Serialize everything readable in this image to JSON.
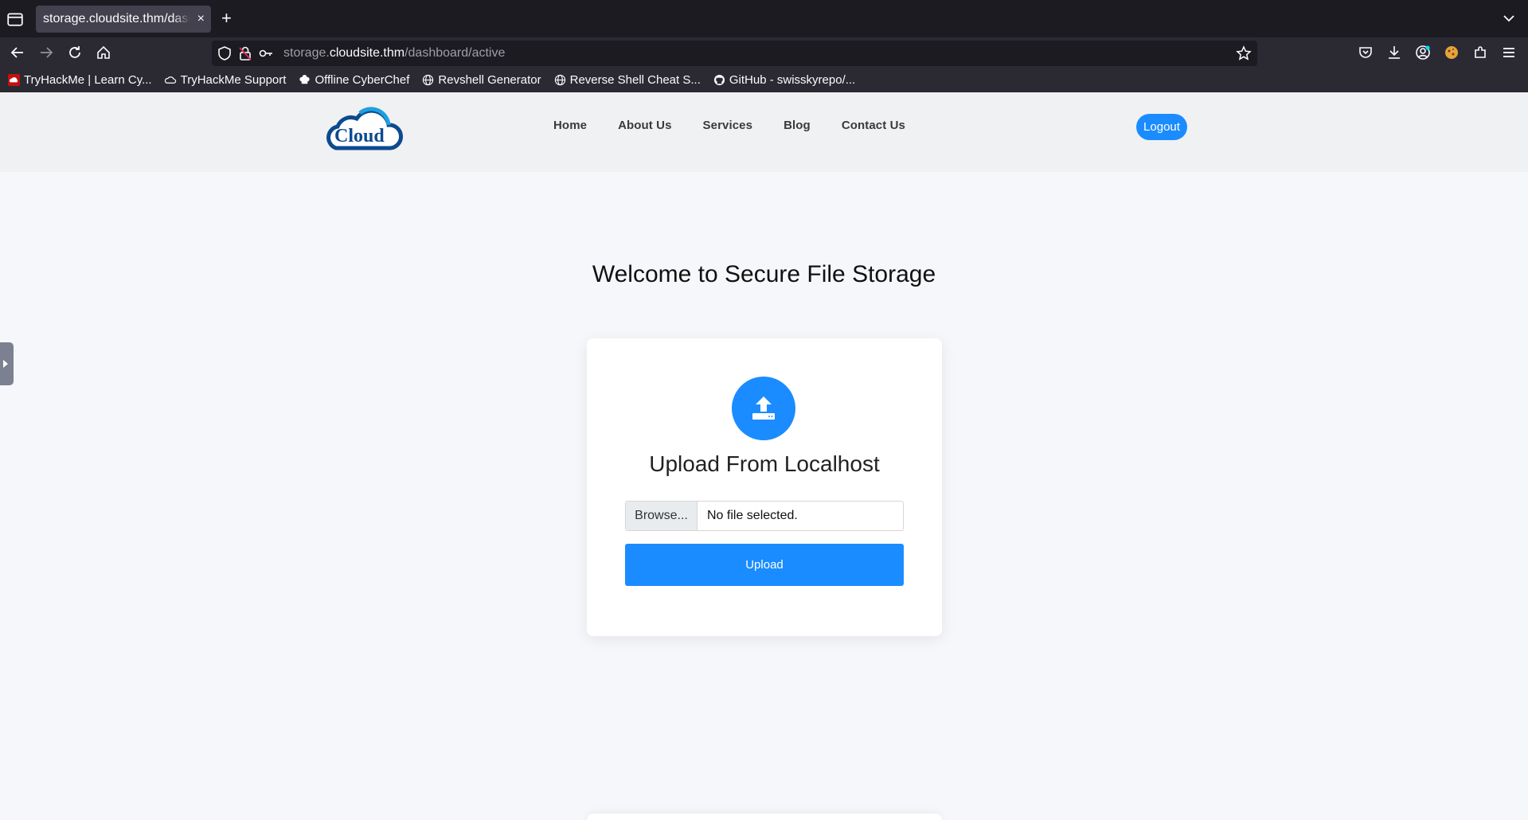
{
  "browser": {
    "tab_title": "storage.cloudsite.thm/dashboard/active",
    "tab_close": "×",
    "new_tab": "+",
    "url_prefix": "storage.",
    "url_domain": "cloudsite.thm",
    "url_path": "/dashboard/active",
    "bookmarks": [
      {
        "label": "TryHackMe | Learn Cy...",
        "icon": "tryhackme-icon"
      },
      {
        "label": "TryHackMe Support",
        "icon": "cloud-icon"
      },
      {
        "label": "Offline CyberChef",
        "icon": "chef-hat-icon"
      },
      {
        "label": "Revshell Generator",
        "icon": "globe-icon"
      },
      {
        "label": "Reverse Shell Cheat S...",
        "icon": "globe-icon"
      },
      {
        "label": "GitHub - swisskyrepo/...",
        "icon": "github-icon"
      }
    ]
  },
  "site": {
    "logo_text": "Cloud",
    "nav": [
      "Home",
      "About Us",
      "Services",
      "Blog",
      "Contact Us"
    ],
    "logout_label": "Logout",
    "welcome_heading": "Welcome to Secure File Storage",
    "upload_card": {
      "title": "Upload From Localhost",
      "browse_label": "Browse...",
      "file_status": "No file selected.",
      "upload_label": "Upload"
    }
  },
  "colors": {
    "accent": "#1a8cff",
    "page_bg": "#f5f7fa",
    "chrome_dark": "#1c1b22",
    "chrome_toolbar": "#2b2a33"
  }
}
